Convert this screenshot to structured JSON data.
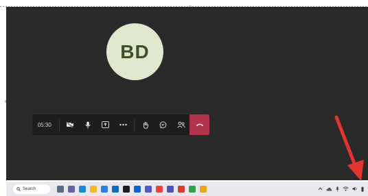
{
  "meeting": {
    "avatar_initials": "BD",
    "timer": "05:30"
  },
  "controls": [
    {
      "name": "camera-off",
      "icon": "camera-off-icon"
    },
    {
      "name": "microphone",
      "icon": "mic-icon"
    },
    {
      "name": "share",
      "icon": "share-tray-icon"
    },
    {
      "name": "more",
      "icon": "more-icon"
    },
    {
      "name": "raise-hand",
      "icon": "hand-icon"
    },
    {
      "name": "chat",
      "icon": "chat-icon"
    },
    {
      "name": "people",
      "icon": "people-icon"
    },
    {
      "name": "hang-up",
      "icon": "phone-hangup-icon"
    }
  ],
  "taskbar": {
    "search_label": "Search",
    "apps": [
      {
        "name": "task-view",
        "color": "#5a6b86"
      },
      {
        "name": "chat-app",
        "color": "#6264a7"
      },
      {
        "name": "edge",
        "color": "#1e88d6"
      },
      {
        "name": "file-explorer",
        "color": "#f2b62d"
      },
      {
        "name": "store",
        "color": "#2b7de0"
      },
      {
        "name": "mail",
        "color": "#0f6cbd"
      },
      {
        "name": "amazon",
        "color": "#1c1c1c"
      },
      {
        "name": "outlook",
        "color": "#0a64c9"
      },
      {
        "name": "teams",
        "color": "#5059c9"
      },
      {
        "name": "chrome",
        "color": "#e8453c"
      },
      {
        "name": "teams-alt",
        "color": "#4b53bc"
      },
      {
        "name": "app-red",
        "color": "#d83b2f"
      },
      {
        "name": "app-green",
        "color": "#30a14e"
      },
      {
        "name": "app-multicolor",
        "color": "#e6a817"
      }
    ]
  },
  "colors": {
    "window_bg": "#2b2a2a",
    "toolbar_bg": "#1f1e1e",
    "hangup": "#b3344b",
    "avatar_bg": "#dfe7cf",
    "arrow": "#e3342f"
  }
}
